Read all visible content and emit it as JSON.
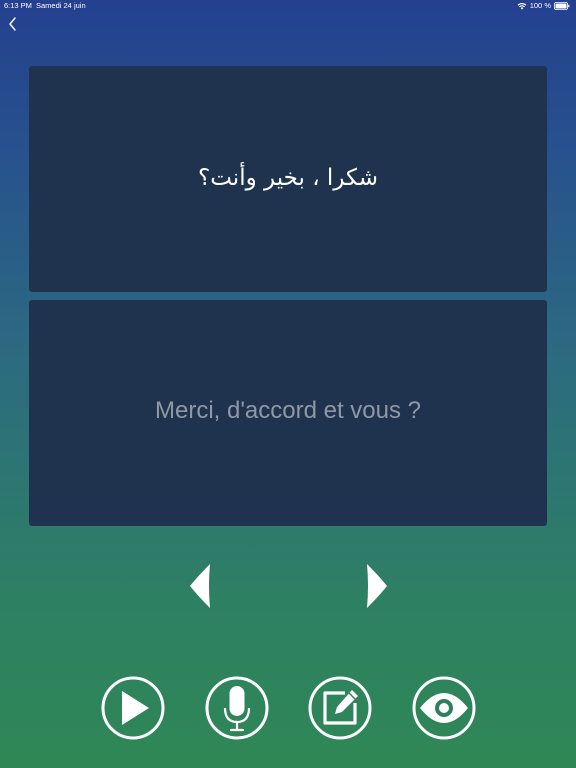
{
  "status_bar": {
    "time": "6:13 PM",
    "date": "Samedi 24 juin",
    "battery": "100 %"
  },
  "cards": {
    "source_text": "شكرا ، بخير وأنت؟",
    "translation_text": "Merci, d'accord et vous ?"
  },
  "navigation": {
    "back_icon": "chevron-left-icon",
    "prev_icon": "arrow-left-icon",
    "next_icon": "arrow-right-icon"
  },
  "actions": [
    {
      "icon": "play-icon"
    },
    {
      "icon": "microphone-icon"
    },
    {
      "icon": "edit-icon"
    },
    {
      "icon": "eye-icon"
    }
  ],
  "colors": {
    "card_background": "#1f334f",
    "translation_text": "#8e98a6",
    "gradient_top": "#24408f",
    "gradient_bottom": "#2f8755"
  }
}
